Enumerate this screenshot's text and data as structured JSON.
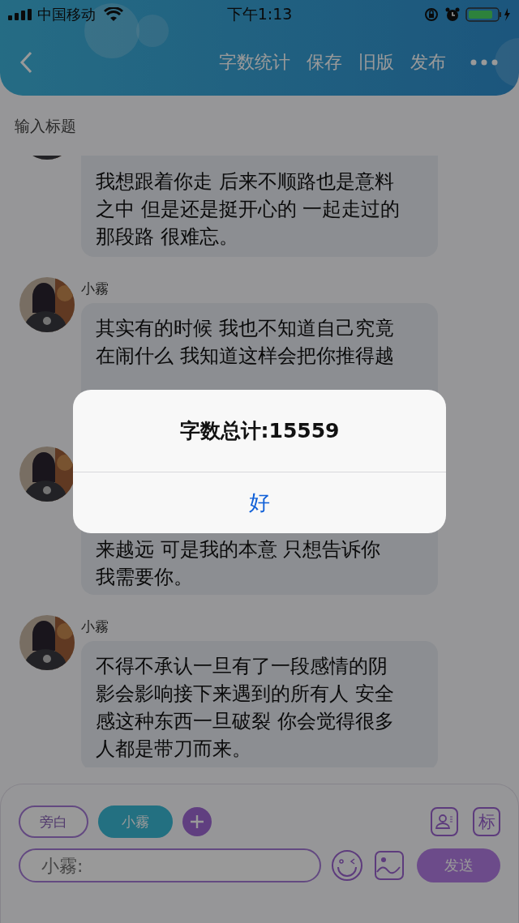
{
  "status_bar": {
    "carrier": "中国移动",
    "time": "下午1:13"
  },
  "nav": {
    "actions": [
      "字数统计",
      "保存",
      "旧版",
      "发布"
    ]
  },
  "title_field": {
    "placeholder": "输入标题"
  },
  "messages": [
    {
      "kind": "cut_top",
      "lines": [
        "我想跟着你走 后来不顺路也是意料",
        "之中 但是还是挺开心的 一起走过的",
        "那段路 很难忘。"
      ]
    },
    {
      "kind": "cut_bottom",
      "name": "小霧",
      "lines": [
        "其实有的时候 我也不知道自己究竟",
        "在闹什么 我知道这样会把你推得越"
      ]
    },
    {
      "kind": "covered_top",
      "lines": [
        "来越远 可是我的本意 只想告诉你",
        "我需要你。"
      ]
    },
    {
      "kind": "full",
      "name": "小霧",
      "lines": [
        "不得不承认一旦有了一段感情的阴",
        "影会影响接下来遇到的所有人 安全",
        "感这种东西一旦破裂 你会觉得很多",
        "人都是带刀而来。"
      ]
    }
  ],
  "composer": {
    "roles": [
      {
        "label": "旁白",
        "selected": false
      },
      {
        "label": "小霧",
        "selected": true
      }
    ],
    "tag_button": "标",
    "input_placeholder": "小霧:",
    "send": "发送"
  },
  "alert": {
    "title": "字数总计:15559",
    "button": "好"
  }
}
